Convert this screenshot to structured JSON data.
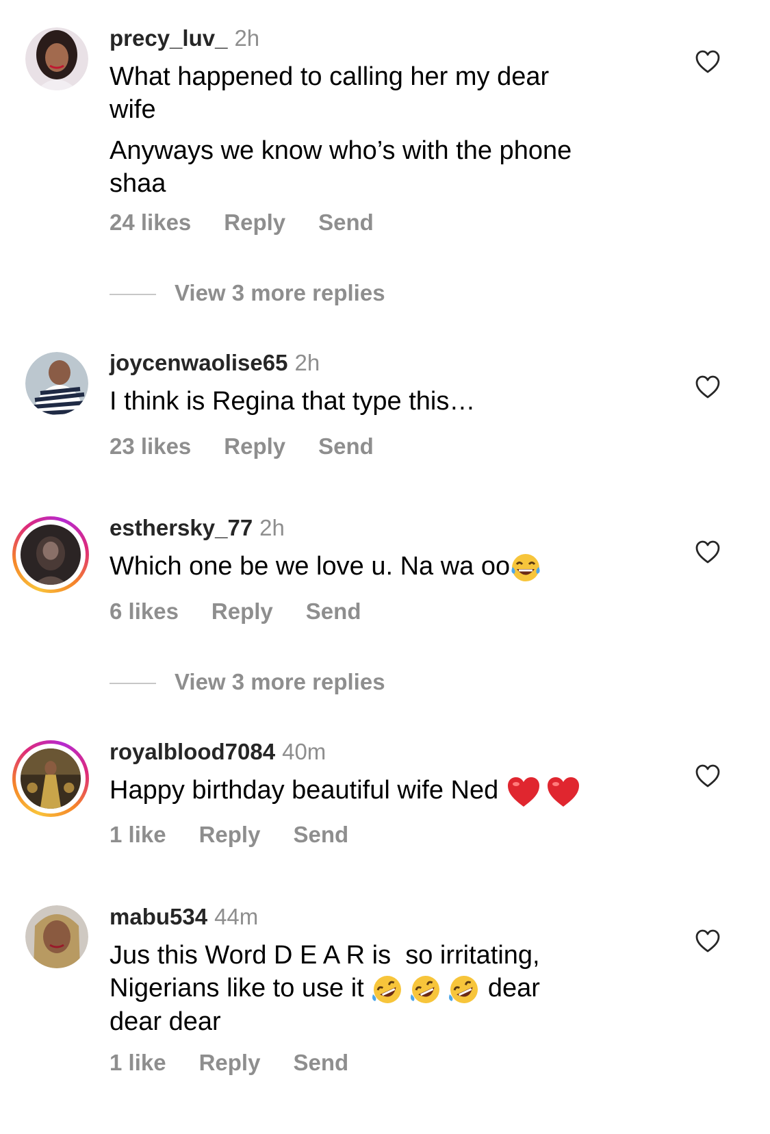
{
  "comments": [
    {
      "username": "precy_luv_",
      "time": "2h",
      "lines": [
        "What happened to calling her my dear wife",
        "Anyways we know who’s with the phone shaa"
      ],
      "likes": "24 likes",
      "reply": "Reply",
      "send": "Send",
      "more_replies": "View 3 more replies"
    },
    {
      "username": "joycenwaolise65",
      "time": "2h",
      "text": "I think is Regina that type this…",
      "likes": "23 likes",
      "reply": "Reply",
      "send": "Send"
    },
    {
      "username": "esthersky_77",
      "time": "2h",
      "text": "Which one be we love u. Na wa oo",
      "emoji": "laughing-tears-emoji",
      "likes": "6 likes",
      "reply": "Reply",
      "send": "Send",
      "more_replies": "View 3 more replies"
    },
    {
      "username": "royalblood7084",
      "time": "40m",
      "text": "Happy birthday beautiful wife Ned",
      "emoji": "red-heart-emoji",
      "likes": "1 like",
      "reply": "Reply",
      "send": "Send"
    },
    {
      "username": "mabu534",
      "time": "44m",
      "text_a": "Jus this Word D E A R is  so irritating,",
      "text_b": "Nigerians like to use it",
      "text_c": "dear",
      "text_d": "dear dear",
      "emoji": "rolling-laughing-emoji",
      "likes": "1 like",
      "reply": "Reply",
      "send": "Send"
    }
  ],
  "icons": {
    "like": "heart-outline-icon"
  },
  "colors": {
    "username": "#262626",
    "meta": "#8e8e8e",
    "story_ring": "#dd2a7b",
    "heart_emoji": "#e0262f"
  }
}
